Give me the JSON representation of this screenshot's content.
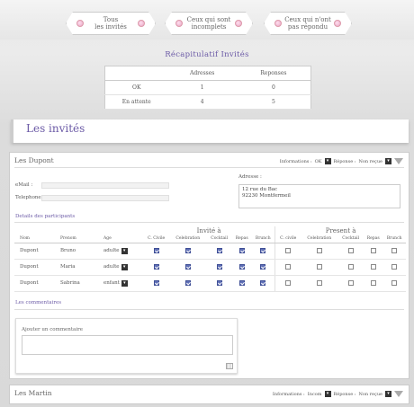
{
  "nav": [
    {
      "label": "Tous\nles invités"
    },
    {
      "label": "Ceux qui sont\nincomplets"
    },
    {
      "label": "Ceux qui n'ont\npas répondu"
    }
  ],
  "recap": {
    "title": "Récapitulatif Invités",
    "headers": [
      "",
      "Adresses",
      "Reponses"
    ],
    "rows": [
      [
        "OK",
        "1",
        "0"
      ],
      [
        "En attente",
        "4",
        "5"
      ]
    ]
  },
  "section_title": "Les invités",
  "family1": {
    "name": "Les Dupont",
    "info_label": "Informations :",
    "info_value": "OK",
    "response_label": "Réponse :",
    "response_value": "Non reçue",
    "email_label": "eMail :",
    "phone_label": "Telephone :",
    "address_label": "Adresse :",
    "address_line1": "12 rue du Bac",
    "address_line2": "92230 Montfermeil",
    "participants_title": "Details des participants",
    "invited_group": "Invité à",
    "present_group": "Present à",
    "columns": [
      "Nom",
      "Prenom",
      "Age",
      "C. Civile",
      "Celebration",
      "Cocktail",
      "Repas",
      "Brunch",
      "C. civile",
      "Celebration",
      "Cocktail",
      "Repas",
      "Brunch"
    ],
    "participants": [
      {
        "nom": "Dupont",
        "prenom": "Bruno",
        "age": "adulte",
        "invited": [
          true,
          true,
          true,
          true,
          true
        ],
        "present": [
          false,
          false,
          false,
          false,
          false
        ]
      },
      {
        "nom": "Dupont",
        "prenom": "Maria",
        "age": "adulte",
        "invited": [
          true,
          true,
          true,
          true,
          true
        ],
        "present": [
          false,
          false,
          false,
          false,
          false
        ]
      },
      {
        "nom": "Dupont",
        "prenom": "Sabrina",
        "age": "enfant",
        "invited": [
          true,
          true,
          true,
          true,
          true
        ],
        "present": [
          false,
          false,
          false,
          false,
          false
        ]
      }
    ],
    "comments_title": "Les commentaires",
    "comment_placeholder": "Ajouter un commentaire"
  },
  "family2": {
    "name": "Les Martin",
    "info_label": "Informations :",
    "info_value": "Incom",
    "response_label": "Réponse :",
    "response_value": "Non reçue"
  },
  "icons": {
    "dropdown": "triangle-down",
    "filter": "funnel-icon",
    "resize": "resize-icon"
  }
}
